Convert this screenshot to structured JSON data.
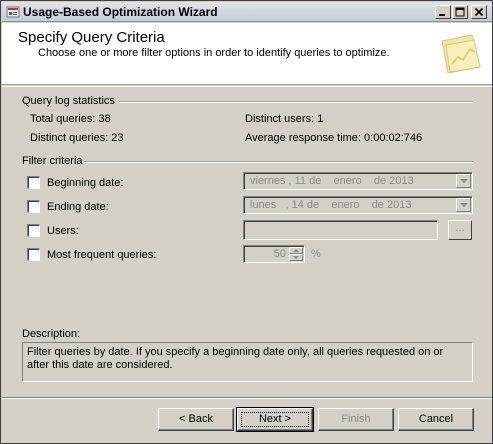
{
  "window": {
    "title": "Usage-Based Optimization Wizard",
    "icon": "wizard-app-icon",
    "controls": [
      "minimize-icon",
      "maximize-icon",
      "close-icon"
    ]
  },
  "header": {
    "title": "Specify Query Criteria",
    "subtitle": "Choose one or more filter options in order to identify queries to optimize.",
    "graphic": "chart-folder-icon"
  },
  "query_log": {
    "group_label": "Query log statistics",
    "total_queries": "Total queries: 38",
    "distinct_users": "Distinct users: 1",
    "distinct_queries": "Distinct queries: 23",
    "avg_response": "Average response time: 0:00:02:746"
  },
  "filter": {
    "group_label": "Filter criteria",
    "beginning_date": {
      "label": "Beginning date:",
      "value": "viernes , 11 de    enero    de 2013",
      "checked": false
    },
    "ending_date": {
      "label": "Ending date:",
      "value": "lunes   , 14 de    enero    de 2013",
      "checked": false
    },
    "users": {
      "label": "Users:",
      "value": "",
      "browse_label": "...",
      "checked": false
    },
    "most_frequent": {
      "label": "Most frequent queries:",
      "value": "50",
      "unit": "%",
      "checked": false
    }
  },
  "description": {
    "label": "Description:",
    "text": "Filter queries by date. If you specify a beginning date only, all queries requested on or after this date are considered."
  },
  "buttons": {
    "back": "< Back",
    "next": "Next >",
    "finish": "Finish",
    "cancel": "Cancel"
  },
  "colors": {
    "dialog_bg": "#d4d0c8",
    "header_bg": "#ffffff",
    "disabled_text": "#8a8a8a"
  }
}
